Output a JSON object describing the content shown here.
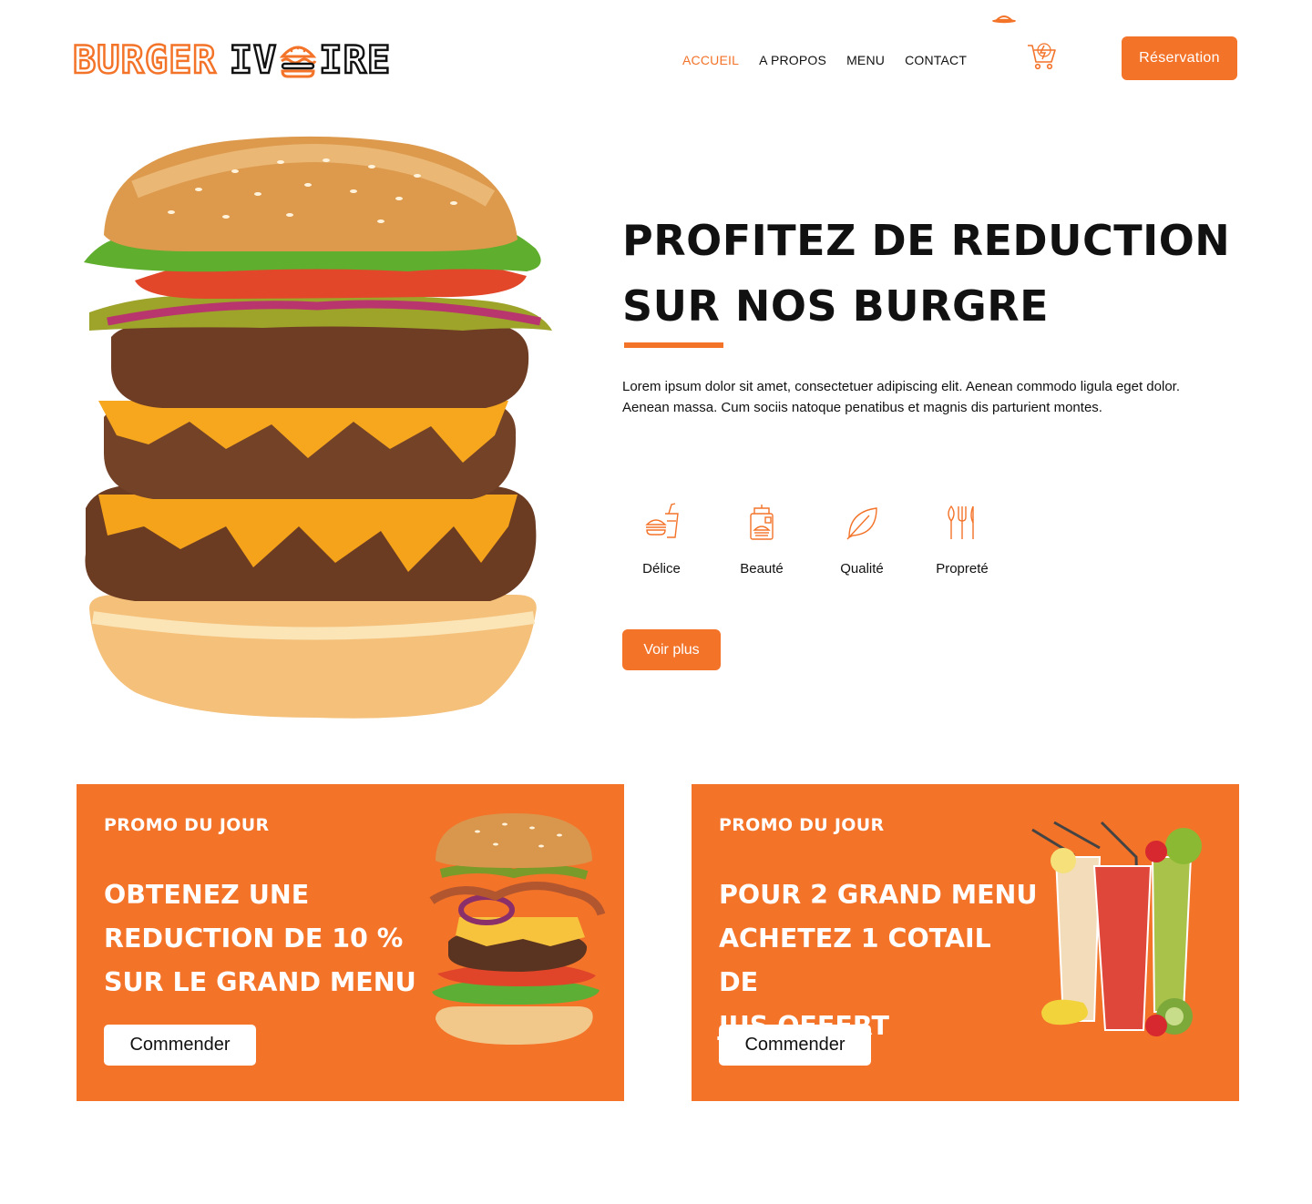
{
  "brand": {
    "logo_part1": "BURGER",
    "logo_part2a": "IV",
    "logo_part2b": "IRE",
    "accent_color": "#f37329"
  },
  "nav": {
    "items": [
      "ACCUEIL",
      "A PROPOS",
      "MENU",
      "CONTACT"
    ],
    "active": "ACCUEIL"
  },
  "header": {
    "cart_icon": "cart-icon",
    "reservation_label": "Réservation"
  },
  "hero": {
    "title_line1": "PROFITEZ DE REDUCTION",
    "title_line2": "SUR NOS BURGRE",
    "text": "Lorem ipsum dolor sit amet, consectetuer adipiscing elit. Aenean commodo ligula eget dolor. Aenean massa. Cum sociis natoque penatibus et magnis dis parturient montes.",
    "features": [
      {
        "label": "Délice",
        "icon": "fast-food-icon"
      },
      {
        "label": "Beauté",
        "icon": "packaged-food-icon"
      },
      {
        "label": "Qualité",
        "icon": "leaf-icon"
      },
      {
        "label": "Propreté",
        "icon": "cutlery-icon"
      }
    ],
    "cta_label": "Voir plus"
  },
  "promos": [
    {
      "label": "PROMO DU JOUR",
      "title_lines": [
        "OBTENEZ UNE",
        "REDUCTION DE 10 %",
        "SUR LE GRAND MENU"
      ],
      "button": "Commender"
    },
    {
      "label": "PROMO DU JOUR",
      "title_lines": [
        "POUR 2 GRAND MENU",
        "ACHETEZ 1 COTAIL DE",
        "JUS OFFERT"
      ],
      "button": "Commender"
    }
  ]
}
